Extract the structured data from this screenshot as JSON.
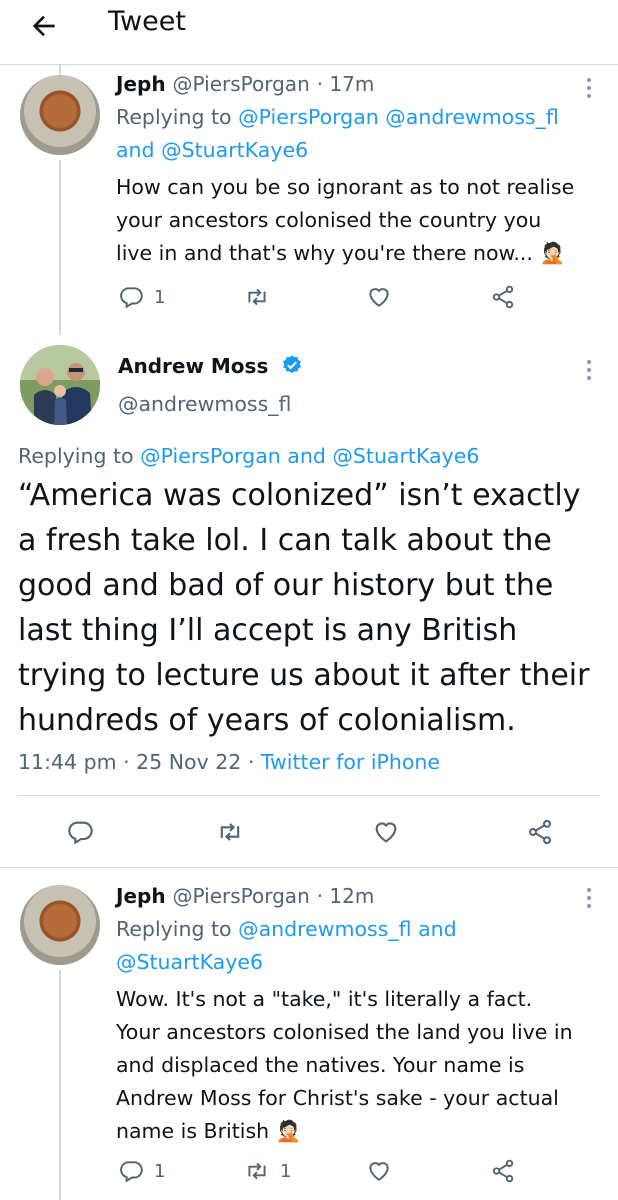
{
  "header": {
    "title": "Tweet"
  },
  "tweets": [
    {
      "name": "Jeph",
      "handle": "@PiersPorgan",
      "time": "· 17m",
      "replying_prefix": "Replying to",
      "replying_to": [
        "@PiersPorgan",
        "@andrewmoss_fl",
        "@StuartKaye6"
      ],
      "joiner": "and",
      "text_lines": [
        "How can you be so ignorant as to not realise",
        "your ancestors colonised the country you",
        "live in and that's why you're there now... 🤦🏻"
      ],
      "reply_count": "1",
      "retweet_count": "",
      "like_count": ""
    },
    {
      "name": "Andrew Moss",
      "handle": "@andrewmoss_fl",
      "verified": true,
      "replying_prefix": "Replying to",
      "replying_to": [
        "@PiersPorgan",
        "@StuartKaye6"
      ],
      "joiner": "and",
      "text_lines": [
        "“America was colonized” isn’t exactly",
        "a fresh take lol. I can talk about the",
        "good and bad of our history but the",
        "last thing I’ll accept is any British",
        "trying to lecture us about it after their",
        "hundreds of years of colonialism."
      ],
      "timestamp": "11:44 pm · 25 Nov 22 ·",
      "source": "Twitter for iPhone"
    },
    {
      "name": "Jeph",
      "handle": "@PiersPorgan",
      "time": "· 12m",
      "replying_prefix": "Replying to",
      "replying_to": [
        "@andrewmoss_fl",
        "@StuartKaye6"
      ],
      "joiner": "and",
      "text_lines": [
        "Wow. It's not a \"take,\" it's  literally a fact.",
        "Your ancestors colonised the land you live in",
        "and displaced the natives. Your name is",
        "Andrew Moss for Christ's sake - your actual",
        "name is British 🤦🏻"
      ],
      "reply_count": "1",
      "retweet_count": "1",
      "like_count": ""
    }
  ],
  "colors": {
    "accent": "#1d9bf0",
    "secondary_text": "#536471",
    "divider": "#cfd9de"
  },
  "icons": [
    "back-arrow-icon",
    "more-icon",
    "reply-icon",
    "retweet-icon",
    "like-icon",
    "share-icon",
    "verified-badge-icon"
  ]
}
